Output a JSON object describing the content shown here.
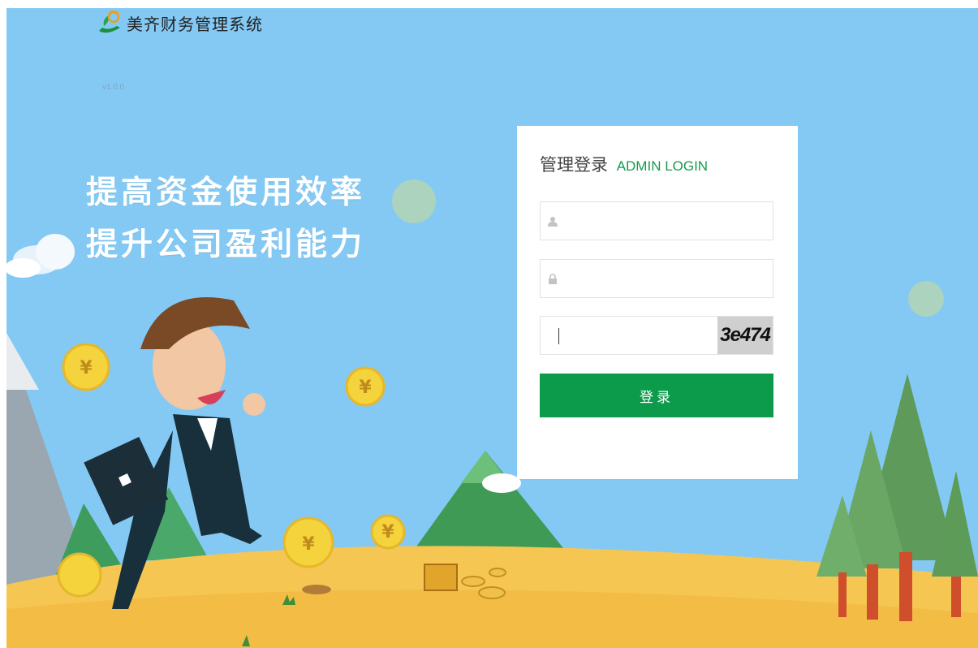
{
  "header": {
    "app_title": "美齐财务管理系统",
    "version": "v1.0.0",
    "logo_icon": "leaf-hand-logo-icon"
  },
  "hero": {
    "slogan_line1": "提高资金使用效率",
    "slogan_line2": "提升公司盈利能力"
  },
  "login": {
    "title_cn": "管理登录",
    "title_en": "ADMIN LOGIN",
    "username": {
      "value": "",
      "placeholder": "",
      "icon": "user-icon"
    },
    "password": {
      "value": "",
      "placeholder": "",
      "icon": "lock-icon"
    },
    "captcha_input": {
      "value": "",
      "placeholder": ""
    },
    "captcha_text": "3e474",
    "submit_label": "登录"
  },
  "colors": {
    "sky": "#84c9f4",
    "accent_green": "#0c9a4b",
    "title_green": "#179a4a",
    "ground": "#f6c652"
  }
}
